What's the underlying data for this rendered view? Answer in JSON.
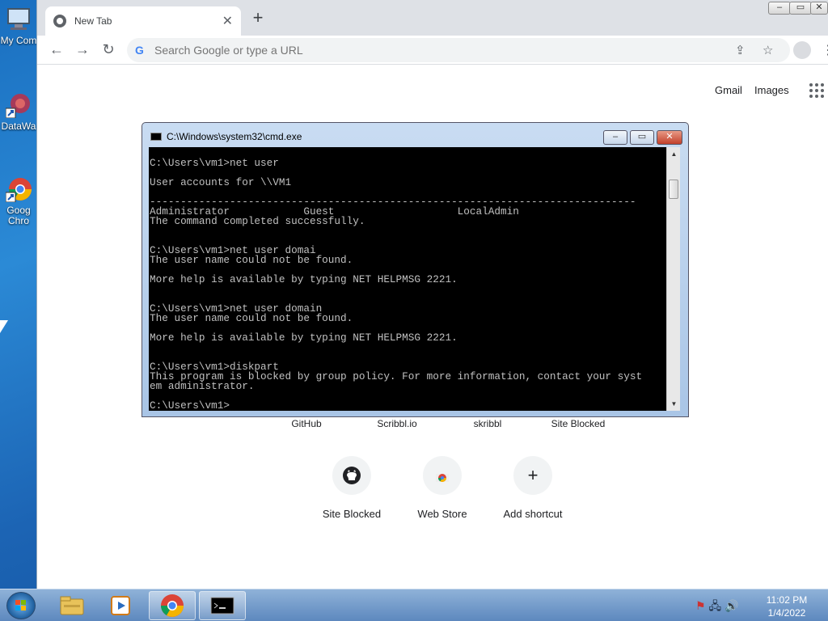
{
  "desktop": {
    "icons": [
      {
        "label": "My Com"
      },
      {
        "label": "DataWa"
      },
      {
        "label": "Goog Chro"
      }
    ]
  },
  "browser": {
    "tab_title": "New Tab",
    "address_placeholder": "Search Google or type a URL",
    "links": {
      "gmail": "Gmail",
      "images": "Images"
    },
    "shortcut_row1": [
      "GitHub",
      "Scribbl.io",
      "skribbl",
      "Site Blocked"
    ],
    "shortcut_row2": [
      {
        "label": "Site Blocked",
        "icon": "github-icon"
      },
      {
        "label": "Web Store",
        "icon": "chrome-web-store-icon"
      },
      {
        "label": "Add shortcut",
        "icon": "plus-icon"
      }
    ]
  },
  "cmd": {
    "title": "C:\\Windows\\system32\\cmd.exe",
    "output": "C:\\Users\\vm1>net user\n\nUser accounts for \\\\VM1\n\n-------------------------------------------------------------------------------\nAdministrator            Guest                    LocalAdmin\nThe command completed successfully.\n\n\nC:\\Users\\vm1>net user domai\nThe user name could not be found.\n\nMore help is available by typing NET HELPMSG 2221.\n\n\nC:\\Users\\vm1>net user domain\nThe user name could not be found.\n\nMore help is available by typing NET HELPMSG 2221.\n\n\nC:\\Users\\vm1>diskpart\nThis program is blocked by group policy. For more information, contact your syst\nem administrator.\n\nC:\\Users\\vm1>"
  },
  "taskbar": {
    "time": "11:02 PM",
    "date": "1/4/2022"
  },
  "colors": {
    "console_bg": "#000000",
    "console_text": "#c0c0c0",
    "desktop_bg": "#1e6fb8",
    "taskbar": "#6d94c6"
  }
}
